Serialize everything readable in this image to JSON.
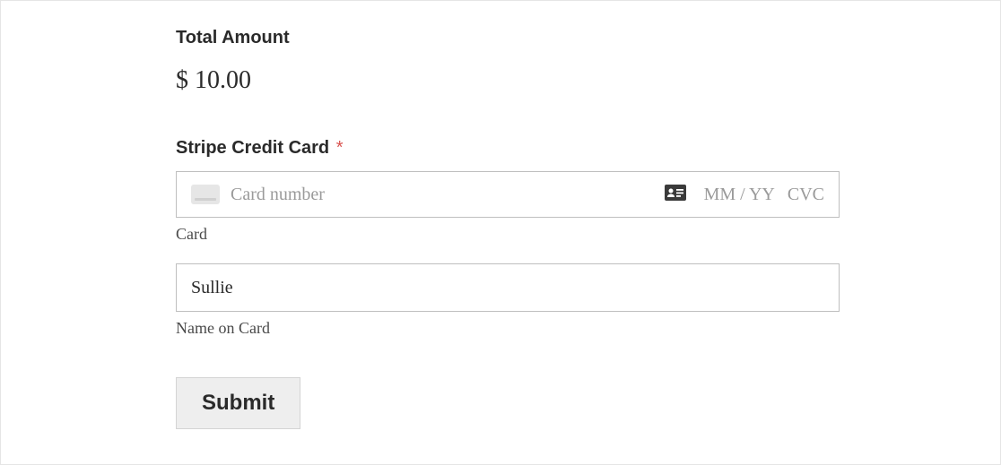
{
  "total": {
    "heading": "Total Amount",
    "amount": "$ 10.00"
  },
  "card_section": {
    "label": "Stripe Credit Card",
    "required_mark": "*",
    "card_number_placeholder": "Card number",
    "expiry_placeholder": "MM / YY",
    "cvc_placeholder": "CVC",
    "card_sublabel": "Card",
    "name_value": "Sullie",
    "name_sublabel": "Name on Card"
  },
  "submit": {
    "label": "Submit"
  }
}
